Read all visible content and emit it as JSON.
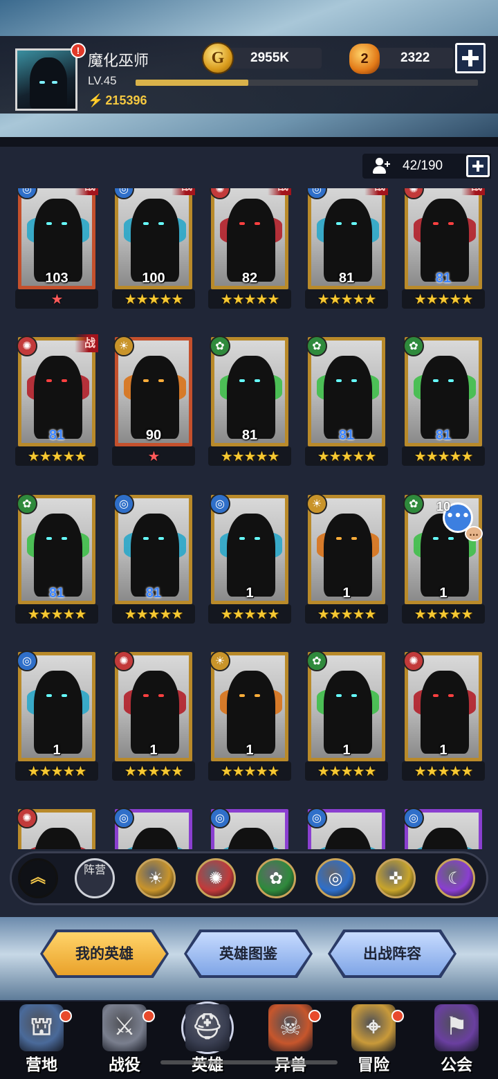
{
  "player": {
    "name": "魔化巫师",
    "level": "LV.45",
    "power": "215396",
    "xp_fraction": 0.33,
    "notification_badge": "!"
  },
  "resources": {
    "gold": "2955K",
    "gems": "2322",
    "gold_icon": "G",
    "gem_icon": "2"
  },
  "heroes": {
    "count": "42/190",
    "battle_tag": "战",
    "cards": [
      {
        "level": "103",
        "stars": 1,
        "level_color": "white",
        "frame": "red",
        "element": "water",
        "battle": true
      },
      {
        "level": "100",
        "stars": 5,
        "level_color": "white",
        "frame": "gold",
        "element": "water",
        "battle": true
      },
      {
        "level": "82",
        "stars": 5,
        "level_color": "white",
        "frame": "gold",
        "element": "fire",
        "battle": true
      },
      {
        "level": "81",
        "stars": 5,
        "level_color": "white",
        "frame": "gold",
        "element": "water",
        "battle": true
      },
      {
        "level": "81",
        "stars": 5,
        "level_color": "blue",
        "frame": "gold",
        "element": "fire",
        "battle": true
      },
      {
        "level": "81",
        "stars": 5,
        "level_color": "blue",
        "frame": "gold",
        "element": "fire",
        "battle": true
      },
      {
        "level": "90",
        "stars": 1,
        "level_color": "white",
        "frame": "red",
        "element": "light",
        "battle": false
      },
      {
        "level": "81",
        "stars": 5,
        "level_color": "white",
        "frame": "gold",
        "element": "nature",
        "battle": false
      },
      {
        "level": "81",
        "stars": 5,
        "level_color": "blue",
        "frame": "gold",
        "element": "nature",
        "battle": false
      },
      {
        "level": "81",
        "stars": 5,
        "level_color": "blue",
        "frame": "gold",
        "element": "nature",
        "battle": false
      },
      {
        "level": "81",
        "stars": 5,
        "level_color": "blue",
        "frame": "gold",
        "element": "nature",
        "battle": false
      },
      {
        "level": "81",
        "stars": 5,
        "level_color": "blue",
        "frame": "gold",
        "element": "water",
        "battle": false
      },
      {
        "level": "1",
        "stars": 5,
        "level_color": "white",
        "frame": "gold",
        "element": "water",
        "battle": false
      },
      {
        "level": "1",
        "stars": 5,
        "level_color": "white",
        "frame": "gold",
        "element": "light",
        "battle": false
      },
      {
        "level": "1",
        "stars": 5,
        "level_color": "white",
        "frame": "gold",
        "element": "nature",
        "battle": false
      },
      {
        "level": "1",
        "stars": 5,
        "level_color": "white",
        "frame": "gold",
        "element": "water",
        "battle": false
      },
      {
        "level": "1",
        "stars": 5,
        "level_color": "white",
        "frame": "gold",
        "element": "fire",
        "battle": false
      },
      {
        "level": "1",
        "stars": 5,
        "level_color": "white",
        "frame": "gold",
        "element": "light",
        "battle": false
      },
      {
        "level": "1",
        "stars": 5,
        "level_color": "white",
        "frame": "gold",
        "element": "nature",
        "battle": false
      },
      {
        "level": "1",
        "stars": 5,
        "level_color": "white",
        "frame": "gold",
        "element": "fire",
        "battle": false
      },
      {
        "level": "",
        "stars": 0,
        "level_color": "white",
        "frame": "gold",
        "element": "fire",
        "battle": false
      },
      {
        "level": "",
        "stars": 0,
        "level_color": "white",
        "frame": "purple",
        "element": "water",
        "battle": false
      },
      {
        "level": "",
        "stars": 0,
        "level_color": "white",
        "frame": "purple",
        "element": "water",
        "battle": false
      },
      {
        "level": "",
        "stars": 0,
        "level_color": "white",
        "frame": "purple",
        "element": "water",
        "battle": false
      },
      {
        "level": "",
        "stars": 0,
        "level_color": "white",
        "frame": "purple",
        "element": "water",
        "battle": false
      }
    ]
  },
  "chat": {
    "count": "10",
    "icon": "•••"
  },
  "filters": {
    "collapse_icon": "︽",
    "faction_label": "阵营",
    "factions": [
      "light",
      "fire",
      "nature",
      "water",
      "holy",
      "dark"
    ]
  },
  "tabs": [
    {
      "label": "我的英雄",
      "active": true
    },
    {
      "label": "英雄图鉴",
      "active": false
    },
    {
      "label": "出战阵容",
      "active": false
    }
  ],
  "nav": [
    {
      "label": "营地",
      "icon": "camp-icon",
      "dot": true
    },
    {
      "label": "战役",
      "icon": "campaign-icon",
      "dot": true
    },
    {
      "label": "英雄",
      "icon": "hero-icon",
      "dot": false,
      "active": true
    },
    {
      "label": "异兽",
      "icon": "beast-icon",
      "dot": true
    },
    {
      "label": "冒险",
      "icon": "adventure-icon",
      "dot": true
    },
    {
      "label": "公会",
      "icon": "guild-icon",
      "dot": false
    }
  ],
  "colors": {
    "accent_gold": "#f6c832",
    "level_blue": "#3d85ff",
    "notification_red": "#e23a2a",
    "fire": "#c23a3a",
    "water": "#2f6fc9",
    "nature": "#2f8a3c",
    "light": "#c9942a",
    "holy": "#c9a52a",
    "dark": "#8a3fd0"
  }
}
